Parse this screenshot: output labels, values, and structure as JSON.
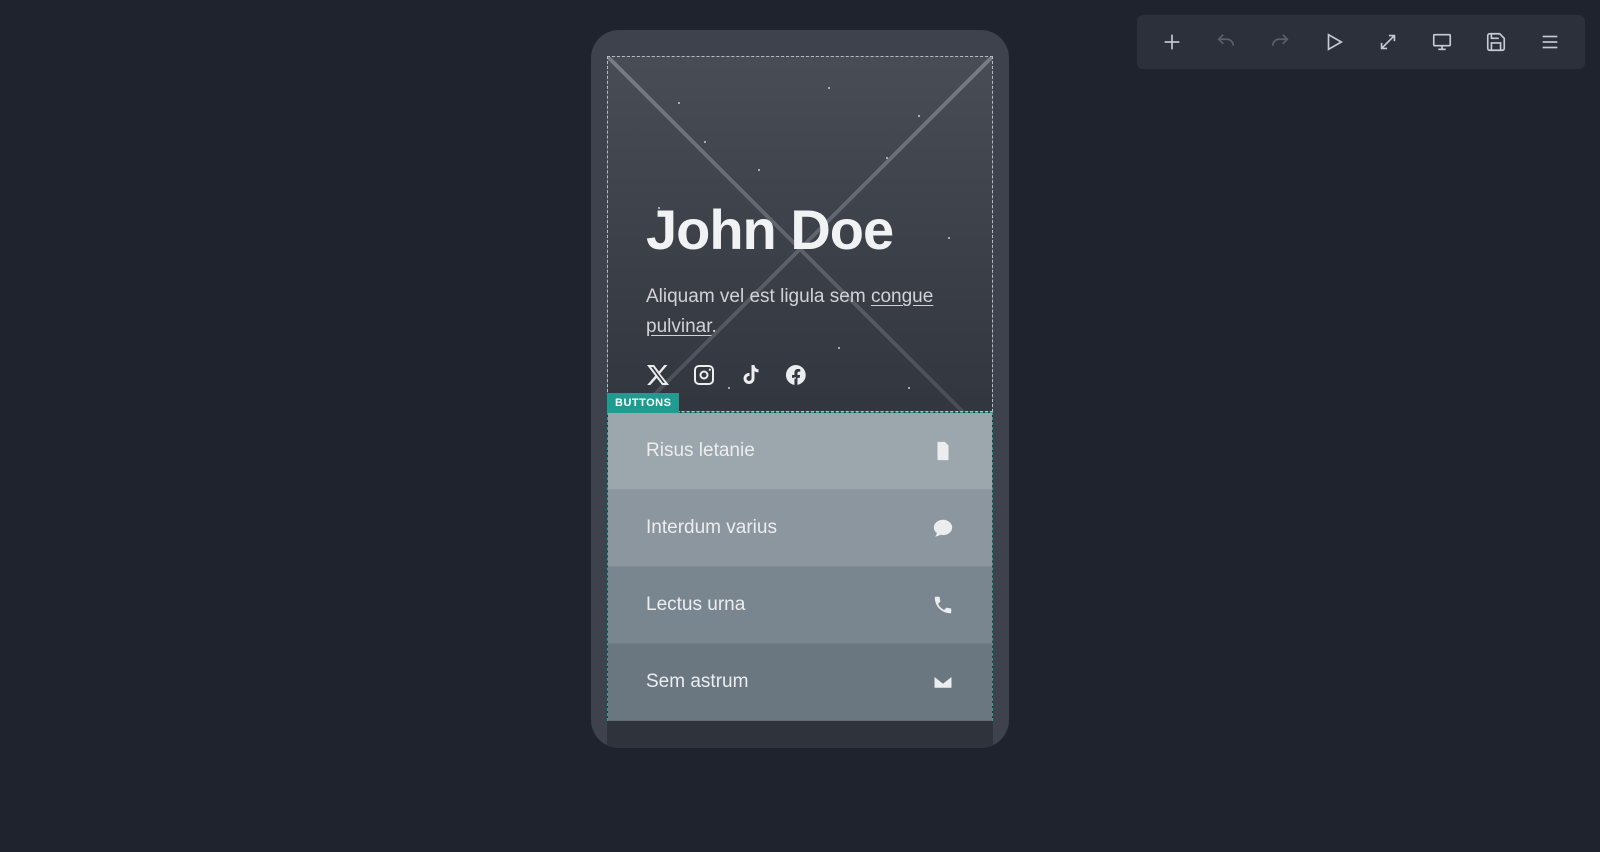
{
  "toolbar": {
    "icons": [
      "plus",
      "undo",
      "redo",
      "play",
      "expand",
      "desktop",
      "save",
      "menu"
    ]
  },
  "banner": {
    "title": "John Doe",
    "subtitle_prefix": "Aliquam vel est ligula sem ",
    "subtitle_link": "congue pulvinar",
    "subtitle_suffix": ".",
    "socials": [
      "x",
      "instagram",
      "tiktok",
      "facebook"
    ]
  },
  "buttons_section": {
    "label": "BUTTONS",
    "items": [
      {
        "label": "Risus letanie",
        "icon": "file"
      },
      {
        "label": "Interdum varius",
        "icon": "chat"
      },
      {
        "label": "Lectus urna",
        "icon": "phone"
      },
      {
        "label": "Sem astrum",
        "icon": "mail"
      }
    ]
  },
  "colors": {
    "accent": "#1d9c8f"
  }
}
